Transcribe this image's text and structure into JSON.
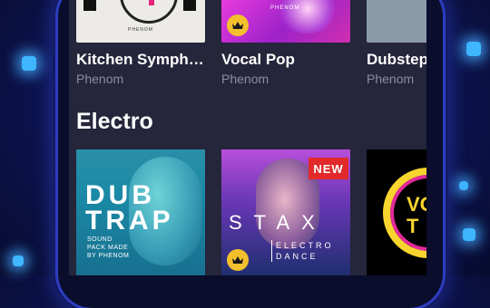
{
  "top_row": [
    {
      "title": "Kitchen Symph…",
      "artist": "Phenom",
      "cover_text": "PHENOM"
    },
    {
      "title": "Vocal Pop",
      "artist": "Phenom",
      "cover_text": "PHENOM"
    },
    {
      "title": "Dubstep",
      "artist": "Phenom"
    }
  ],
  "section": {
    "title": "Electro"
  },
  "electro_row": [
    {
      "cover_lines": [
        "DUB",
        "TRAP"
      ],
      "cover_small": [
        "SOUND",
        "PACK MADE",
        "BY PHENOM"
      ]
    },
    {
      "badge": "NEW",
      "cover_word": "STAX",
      "cover_sub": [
        "ELECTRO",
        "DANCE"
      ]
    },
    {
      "cover_lines": [
        "VO",
        "T"
      ]
    }
  ],
  "colors": {
    "screen_bg": "#25253b",
    "title": "#ffffff",
    "subtitle": "#8d8da2",
    "crown": "#f3bf2d",
    "new_badge": "#e22a2a"
  },
  "icons": {
    "premium": "crown-icon"
  }
}
